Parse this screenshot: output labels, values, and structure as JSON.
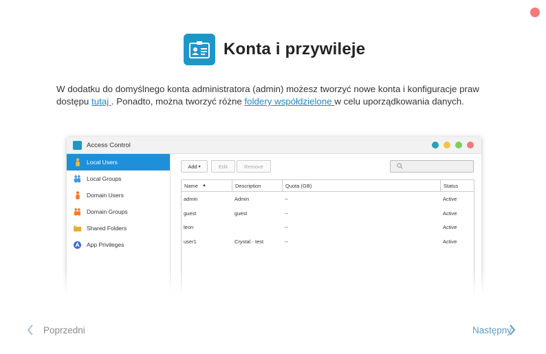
{
  "wizard": {
    "title": "Konta i przywileje",
    "intro": {
      "part1": "W dodatku do domyślnego konta administratora (admin) możesz tworzyć nowe konta i konfiguracje praw dostępu ",
      "link1": "tutaj ",
      "part2": ". Ponadto, można tworzyć różne ",
      "link2": "foldery współdzielone ",
      "part3": "w celu uporządkowania danych."
    },
    "prev_label": "Poprzedni",
    "next_label": "Następny"
  },
  "window": {
    "title": "Access Control",
    "dots": [
      "#26a3b6",
      "#f5c342",
      "#7ccf5b",
      "#f07a7a"
    ],
    "sidebar": [
      {
        "label": "Local Users",
        "icon": "user-icon",
        "active": true
      },
      {
        "label": "Local Groups",
        "icon": "group-icon",
        "active": false
      },
      {
        "label": "Domain Users",
        "icon": "domain-user-icon",
        "active": false
      },
      {
        "label": "Domain Groups",
        "icon": "domain-group-icon",
        "active": false
      },
      {
        "label": "Shared Folders",
        "icon": "folder-icon",
        "active": false
      },
      {
        "label": "App Privileges",
        "icon": "app-privileges-icon",
        "active": false
      }
    ],
    "toolbar": {
      "add": "Add",
      "edit": "Edit",
      "remove": "Remove"
    },
    "columns": [
      "Name",
      "Description",
      "Quota (GB)",
      "Status"
    ],
    "rows": [
      [
        "admin",
        "Admin",
        "--",
        "Active"
      ],
      [
        "guest",
        "guest",
        "--",
        "Active"
      ],
      [
        "leon",
        "",
        "--",
        "Active"
      ],
      [
        "user1",
        "Crystal - test",
        "--",
        "Active"
      ]
    ]
  }
}
